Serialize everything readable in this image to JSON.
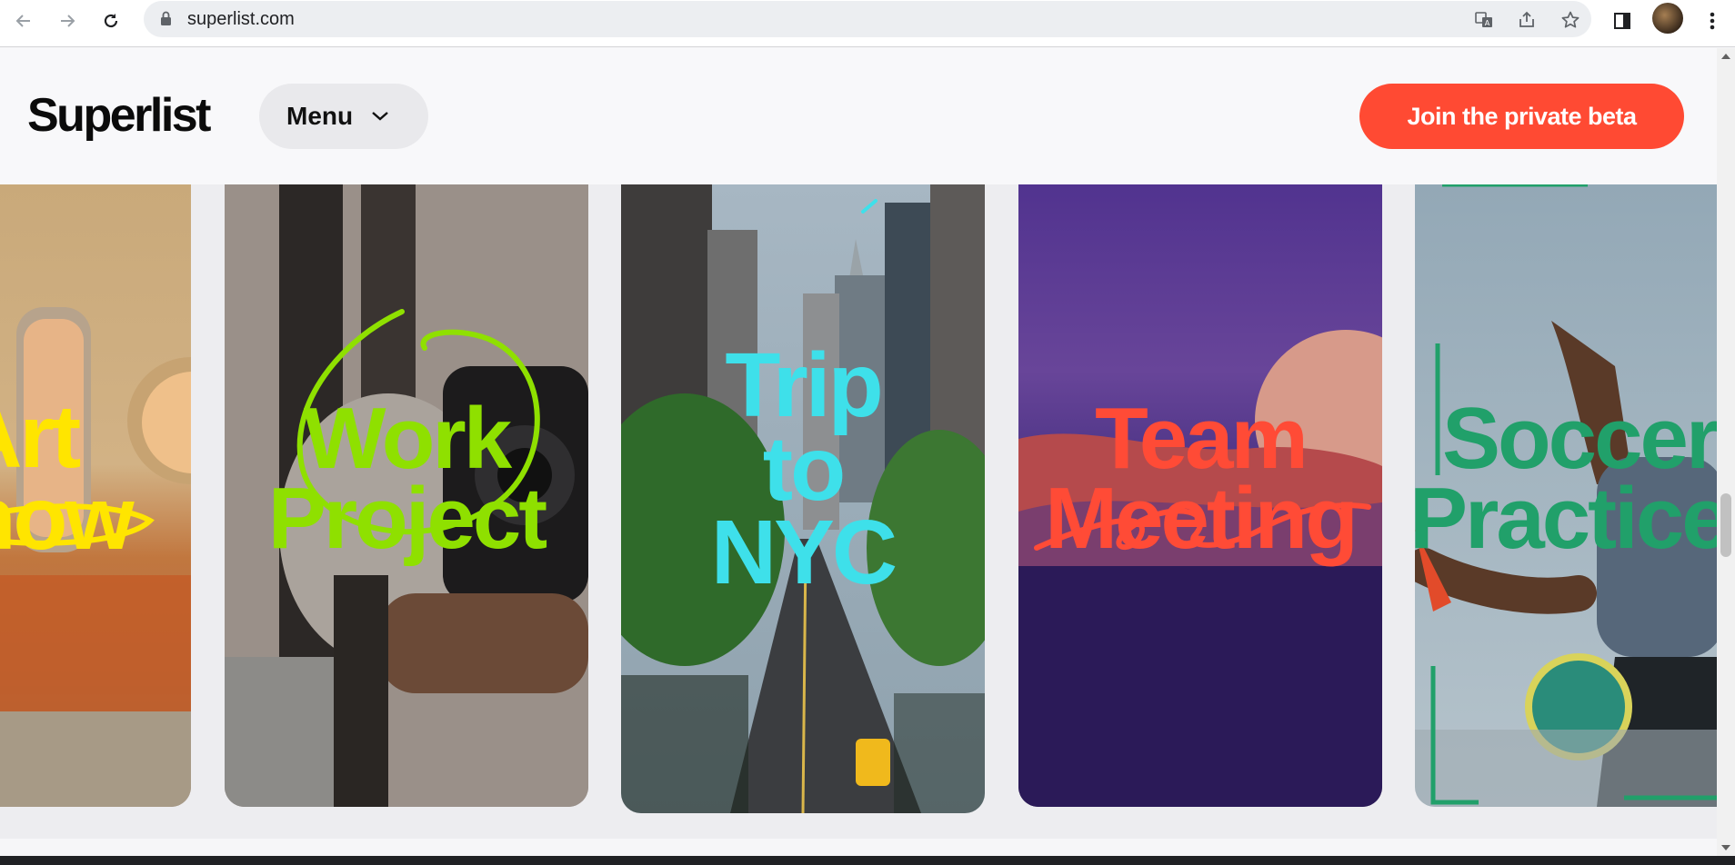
{
  "browser": {
    "url": "superlist.com",
    "back_icon": "arrow-left-icon",
    "forward_icon": "arrow-right-icon",
    "reload_icon": "reload-icon",
    "lock_icon": "lock-icon",
    "translate_icon": "translate-icon",
    "share_icon": "share-icon",
    "bookmark_icon": "star-icon",
    "sidepanel_icon": "side-panel-icon",
    "menu_icon": "kebab-icon"
  },
  "header": {
    "logo": "Superlist",
    "menu_label": "Menu",
    "menu_icon": "chevron-down-icon",
    "cta_label": "Join the private beta",
    "cta_color": "#ff4a33"
  },
  "cards": [
    {
      "line1": "Art",
      "line2": "Show",
      "color": "#ffe500"
    },
    {
      "line1": "Work",
      "line2": "Project",
      "color": "#8fe000"
    },
    {
      "line1": "Trip",
      "line2": "to",
      "line3": "NYC",
      "color": "#3ee0ea"
    },
    {
      "line1": "Team",
      "line2": "Meeting",
      "color": "#ff4b36"
    },
    {
      "line1": "Soccer",
      "line2": "Practice",
      "color": "#21a06a"
    }
  ]
}
